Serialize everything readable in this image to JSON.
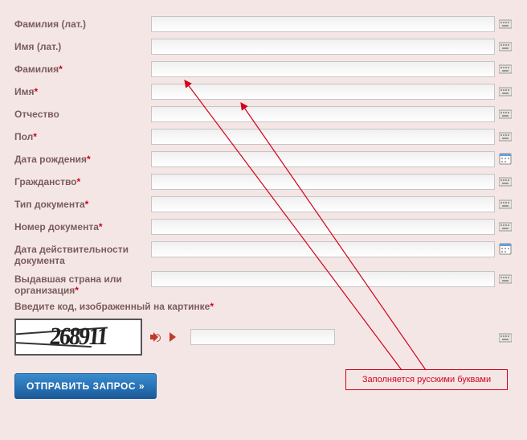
{
  "fields": {
    "surname_lat": {
      "label": "Фамилия (лат.)",
      "required": false,
      "icon": "kb"
    },
    "name_lat": {
      "label": "Имя (лат.)",
      "required": false,
      "icon": "kb"
    },
    "surname": {
      "label": "Фамилия",
      "required": true,
      "icon": "kb"
    },
    "name": {
      "label": "Имя",
      "required": true,
      "icon": "kb"
    },
    "patronymic": {
      "label": "Отчество",
      "required": false,
      "icon": "kb"
    },
    "gender": {
      "label": "Пол",
      "required": true,
      "icon": "kb"
    },
    "birthdate": {
      "label": "Дата рождения",
      "required": true,
      "icon": "cal"
    },
    "citizenship": {
      "label": "Гражданство",
      "required": true,
      "icon": "kb"
    },
    "doc_type": {
      "label": "Тип документа",
      "required": true,
      "icon": "kb"
    },
    "doc_number": {
      "label": "Номер документа",
      "required": true,
      "icon": "kb"
    },
    "doc_validity": {
      "label": "Дата действительности документа",
      "required": false,
      "icon": "cal"
    },
    "issuer": {
      "label": "Выдавшая страна или организация",
      "required": true,
      "icon": "kb"
    }
  },
  "captcha": {
    "label": "Введите код, изображенный на картинке",
    "required": true,
    "code": "268911"
  },
  "annotation": "Заполняется русскими буквами",
  "submit": "ОТПРАВИТЬ ЗАПРОС »",
  "required_mark": "*"
}
